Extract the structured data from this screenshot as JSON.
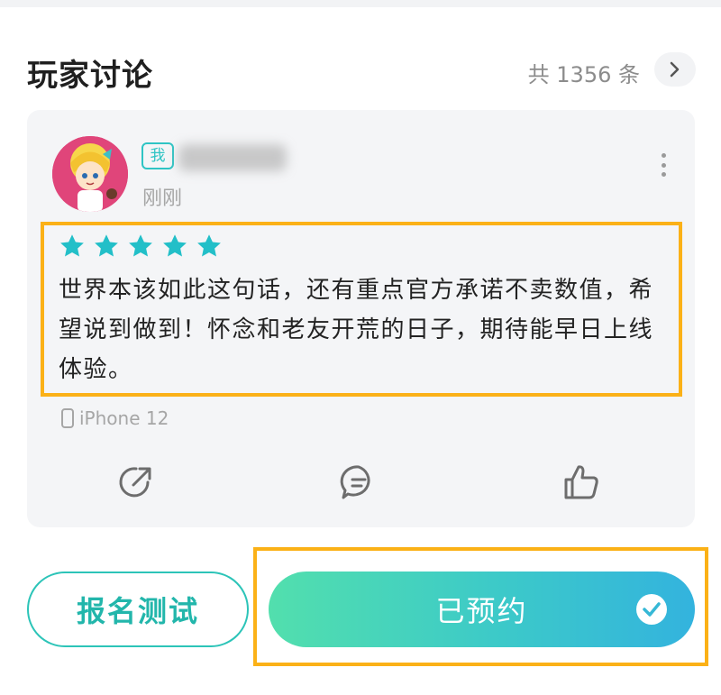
{
  "section": {
    "title": "玩家讨论",
    "count": "共 1356 条"
  },
  "review": {
    "me_badge": "我",
    "time": "刚刚",
    "rating": 5,
    "text": "世界本该如此这句话，还有重点官方承诺不卖数值，希望说到做到！怀念和老友开荒的日子，期待能早日上线体验。",
    "device": "iPhone 12"
  },
  "colors": {
    "accent": "#2ec4c4",
    "star": "#22bfc8",
    "highlight": "#fbb117"
  },
  "bottom": {
    "signup_label": "报名测试",
    "reserve_label": "已预约"
  }
}
